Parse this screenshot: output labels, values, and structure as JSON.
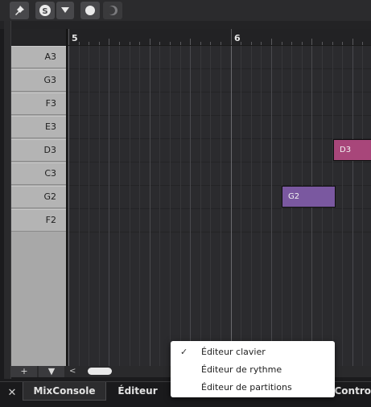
{
  "toolbar": {
    "buttons": [
      {
        "name": "pin-icon"
      },
      {
        "name": "solo-s-icon",
        "label": "S"
      },
      {
        "name": "dropdown-arrow-icon"
      },
      {
        "name": "record-circle-icon"
      },
      {
        "name": "moon-icon"
      }
    ]
  },
  "ruler": {
    "bar_5": "5",
    "bar_6": "6"
  },
  "keys": [
    "A3",
    "G3",
    "F3",
    "E3",
    "D3",
    "C3",
    "G2",
    "F2"
  ],
  "notes": [
    {
      "label": "D3",
      "color": "#a8467a"
    },
    {
      "label": "G2",
      "color": "#7a58a0"
    }
  ],
  "bottom": {
    "plus": "+",
    "arrow": "▼",
    "left_arrow": "<"
  },
  "tabs": {
    "close": "✕",
    "mixconsole": "MixConsole",
    "editeur": "Éditeur",
    "partial": "r Contro"
  },
  "menu": {
    "items": [
      {
        "label": "Éditeur clavier",
        "checked": "✓"
      },
      {
        "label": "Éditeur de rythme"
      },
      {
        "label": "Éditeur de partitions"
      }
    ]
  },
  "colors": {
    "background": "#1b1b1d",
    "grid": "#2b2b2e",
    "keys": "#b4b4b4",
    "note_d3": "#a8467a",
    "note_g2": "#7a58a0"
  }
}
